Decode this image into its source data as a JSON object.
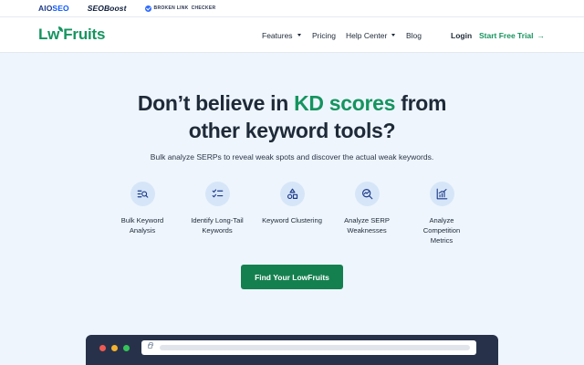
{
  "partners": {
    "aioseo_pre": "AIO",
    "aioseo_post": "SEO",
    "seoboost": "SEOBoost",
    "blc_pre": "BROKEN LINK",
    "blc_post": "CHECKER"
  },
  "nav": {
    "logo_lw": "Lw",
    "logo_rest": "Fruits",
    "items": [
      {
        "label": "Features",
        "dropdown": true
      },
      {
        "label": "Pricing",
        "dropdown": false
      },
      {
        "label": "Help Center",
        "dropdown": true
      },
      {
        "label": "Blog",
        "dropdown": false
      }
    ],
    "login": "Login",
    "trial": "Start Free Trial",
    "trial_arrow": "→"
  },
  "hero": {
    "title_part1": "Don’t believe in ",
    "title_accent": "KD scores",
    "title_part2": " from",
    "title_line2": "other keyword tools?",
    "subtitle": "Bulk analyze SERPs to reveal weak spots and discover the actual weak keywords."
  },
  "features": [
    {
      "line1": "Bulk Keyword",
      "line2": "Analysis",
      "line3": "",
      "icon": "bulk-search-icon"
    },
    {
      "line1": "Identify Long-Tail",
      "line2": "Keywords",
      "line3": "",
      "icon": "checklist-icon"
    },
    {
      "line1": "Keyword Clustering",
      "line2": "",
      "line3": "",
      "icon": "shapes-icon"
    },
    {
      "line1": "Analyze SERP",
      "line2": "Weaknesses",
      "line3": "",
      "icon": "magnify-chart-icon"
    },
    {
      "line1": "Analyze",
      "line2": "Competition",
      "line3": "Metrics",
      "icon": "growth-chart-icon"
    }
  ],
  "cta": {
    "label": "Find Your LowFruits"
  },
  "colors": {
    "brand_green": "#15945f",
    "cta_green": "#15804f",
    "hero_bg": "#eef5fd",
    "icon_circle": "#d6e6f8",
    "icon_stroke": "#1e3a8a",
    "browser_frame": "#27324a",
    "dot_red": "#ef5a52",
    "dot_yellow": "#f5b12e",
    "dot_green": "#35c45a"
  }
}
